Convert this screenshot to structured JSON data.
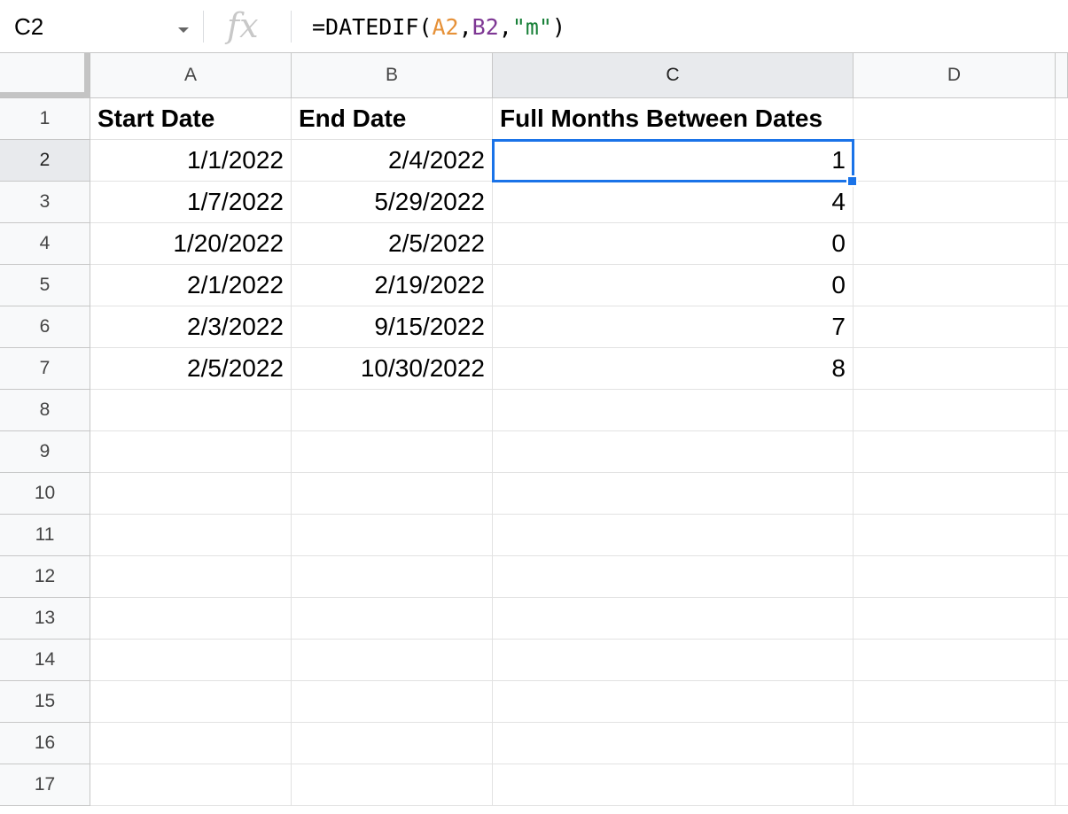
{
  "formula_bar": {
    "name_box": "C2",
    "fx_label": "fx",
    "formula_parts": [
      {
        "text": "=DATEDIF(",
        "color": "#000000"
      },
      {
        "text": "A2",
        "color": "#e69138"
      },
      {
        "text": ",",
        "color": "#000000"
      },
      {
        "text": "B2",
        "color": "#7e3794"
      },
      {
        "text": ",",
        "color": "#000000"
      },
      {
        "text": "\"m\"",
        "color": "#188038"
      },
      {
        "text": ")",
        "color": "#000000"
      }
    ]
  },
  "grid": {
    "columns": [
      "A",
      "B",
      "C",
      "D"
    ],
    "selected_column": "C",
    "selected_row": 2,
    "rows": [
      {
        "num": "1",
        "cells": [
          "Start Date",
          "End Date",
          "Full Months Between Dates",
          ""
        ]
      },
      {
        "num": "2",
        "cells": [
          "1/1/2022",
          "2/4/2022",
          "1",
          ""
        ]
      },
      {
        "num": "3",
        "cells": [
          "1/7/2022",
          "5/29/2022",
          "4",
          ""
        ]
      },
      {
        "num": "4",
        "cells": [
          "1/20/2022",
          "2/5/2022",
          "0",
          ""
        ]
      },
      {
        "num": "5",
        "cells": [
          "2/1/2022",
          "2/19/2022",
          "0",
          ""
        ]
      },
      {
        "num": "6",
        "cells": [
          "2/3/2022",
          "9/15/2022",
          "7",
          ""
        ]
      },
      {
        "num": "7",
        "cells": [
          "2/5/2022",
          "10/30/2022",
          "8",
          ""
        ]
      },
      {
        "num": "8",
        "cells": [
          "",
          "",
          "",
          ""
        ]
      },
      {
        "num": "9",
        "cells": [
          "",
          "",
          "",
          ""
        ]
      },
      {
        "num": "10",
        "cells": [
          "",
          "",
          "",
          ""
        ]
      },
      {
        "num": "11",
        "cells": [
          "",
          "",
          "",
          ""
        ]
      },
      {
        "num": "12",
        "cells": [
          "",
          "",
          "",
          ""
        ]
      },
      {
        "num": "13",
        "cells": [
          "",
          "",
          "",
          ""
        ]
      },
      {
        "num": "14",
        "cells": [
          "",
          "",
          "",
          ""
        ]
      },
      {
        "num": "15",
        "cells": [
          "",
          "",
          "",
          ""
        ]
      },
      {
        "num": "16",
        "cells": [
          "",
          "",
          "",
          ""
        ]
      },
      {
        "num": "17",
        "cells": [
          "",
          "",
          "",
          ""
        ]
      }
    ]
  },
  "colors": {
    "selection": "#1a73e8",
    "header_bg": "#f8f9fa",
    "selected_header_bg": "#e8eaed"
  }
}
